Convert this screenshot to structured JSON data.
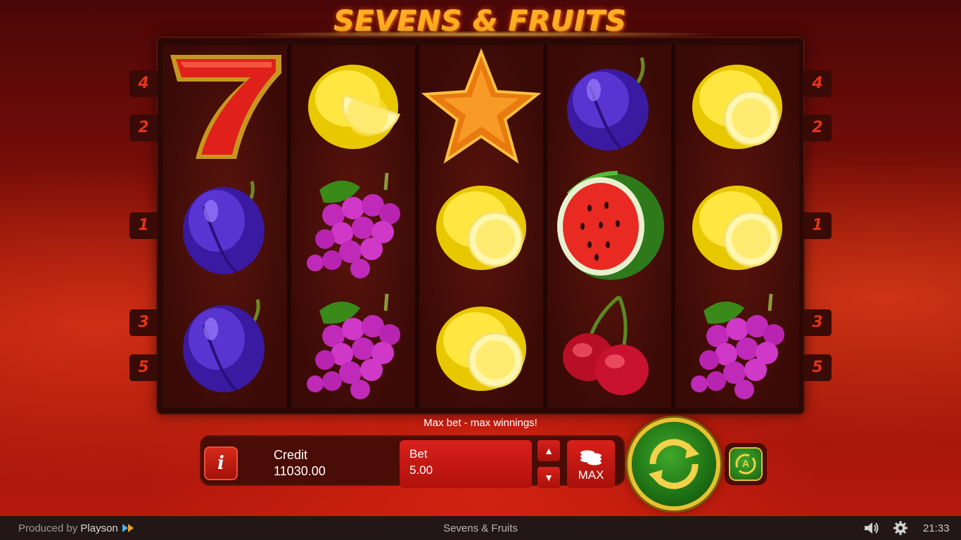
{
  "game": {
    "title": "SEVENS & FRUITS",
    "reels": [
      [
        "seven",
        "plum",
        "plum"
      ],
      [
        "lemon",
        "grapes",
        "grapes"
      ],
      [
        "star",
        "lemon",
        "lemon"
      ],
      [
        "plum",
        "watermelon",
        "cherries"
      ],
      [
        "lemon",
        "lemon",
        "grapes"
      ]
    ],
    "paylines_left": [
      "4",
      "2",
      "1",
      "3",
      "5"
    ],
    "paylines_right": [
      "4",
      "2",
      "1",
      "3",
      "5"
    ]
  },
  "panel": {
    "message": "Max bet - max winnings!",
    "info_label": "i",
    "credit_label": "Credit",
    "credit_value": "11030.00",
    "bet_label": "Bet",
    "bet_value": "5.00",
    "bet_up": "▲",
    "bet_down": "▼",
    "max_label": "MAX",
    "auto_label": "A"
  },
  "footer": {
    "produced_by": "Produced by ",
    "brand": "Playson",
    "title": "Sevens & Fruits",
    "clock": "21:33"
  },
  "colors": {
    "accent_gold": "#e6c230",
    "spin_green": "#1e7014",
    "panel_red": "#d8201a"
  },
  "icons": {
    "sound": "speaker-icon",
    "settings": "gear-icon",
    "spin": "spin-arrows-icon",
    "autoplay": "autoplay-icon",
    "coins": "coin-stack-icon"
  }
}
